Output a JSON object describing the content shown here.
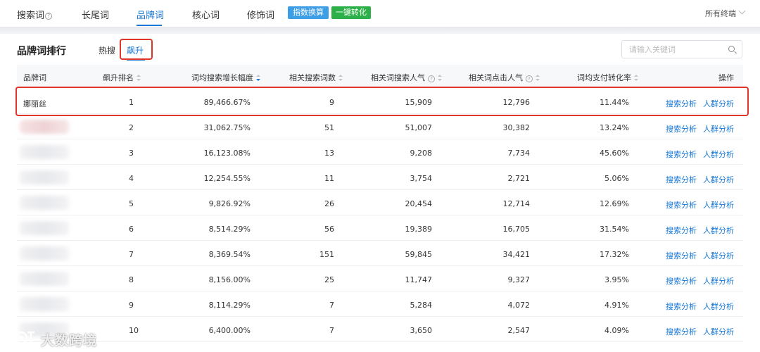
{
  "topnav": {
    "tabs": [
      {
        "label": "搜索词",
        "help": "?"
      },
      {
        "label": "长尾词"
      },
      {
        "label": "品牌词"
      },
      {
        "label": "核心词"
      },
      {
        "label": "修饰词"
      }
    ],
    "active_tab": "品牌词",
    "index_convert_label": "指数换算",
    "one_click_convert_label": "一键转化",
    "terminal_label": "所有终端",
    "colors": {
      "accent": "#1677d6",
      "index_convert": "#3d9ee6",
      "one_click_convert": "#2db04a",
      "highlight": "#e0352b"
    }
  },
  "toolbar": {
    "title": "品牌词排行",
    "subtabs": [
      {
        "label": "热搜"
      },
      {
        "label": "飙升"
      }
    ],
    "active_subtab": "飙升",
    "search_placeholder": "请输入关键词",
    "search_icon": "search-icon"
  },
  "table": {
    "columns": {
      "brand": "品牌词",
      "rank": "飙升排名",
      "growth": "词均搜索增长幅度",
      "count": "相关搜索词数",
      "search_pop": "相关词搜索人气",
      "click_pop": "相关词点击人气",
      "conv": "词均支付转化率",
      "ops": "操作"
    },
    "help_mark": "?",
    "action_search": "搜索分析",
    "action_crowd": "人群分析",
    "rows": [
      {
        "brand": "娜丽丝",
        "rank": "1",
        "growth": "89,466.67%",
        "count": "9",
        "search_pop": "15,909",
        "click_pop": "12,796",
        "conv": "11.44%"
      },
      {
        "brand": "",
        "rank": "2",
        "growth": "31,062.75%",
        "count": "51",
        "search_pop": "51,007",
        "click_pop": "30,382",
        "conv": "13.24%"
      },
      {
        "brand": "",
        "rank": "3",
        "growth": "16,123.08%",
        "count": "13",
        "search_pop": "9,208",
        "click_pop": "7,734",
        "conv": "45.60%"
      },
      {
        "brand": "",
        "rank": "4",
        "growth": "12,254.55%",
        "count": "11",
        "search_pop": "3,754",
        "click_pop": "2,721",
        "conv": "5.06%"
      },
      {
        "brand": "",
        "rank": "5",
        "growth": "9,826.92%",
        "count": "26",
        "search_pop": "20,454",
        "click_pop": "12,714",
        "conv": "12.69%"
      },
      {
        "brand": "",
        "rank": "6",
        "growth": "8,514.29%",
        "count": "56",
        "search_pop": "19,389",
        "click_pop": "16,705",
        "conv": "31.54%"
      },
      {
        "brand": "",
        "rank": "7",
        "growth": "8,369.54%",
        "count": "151",
        "search_pop": "59,845",
        "click_pop": "34,421",
        "conv": "17.32%"
      },
      {
        "brand": "",
        "rank": "8",
        "growth": "8,156.00%",
        "count": "25",
        "search_pop": "11,747",
        "click_pop": "9,327",
        "conv": "3.95%"
      },
      {
        "brand": "",
        "rank": "9",
        "growth": "8,114.29%",
        "count": "7",
        "search_pop": "5,284",
        "click_pop": "4,072",
        "conv": "4.91%"
      },
      {
        "brand": "",
        "rank": "10",
        "growth": "6,400.00%",
        "count": "7",
        "search_pop": "3,650",
        "click_pop": "2,547",
        "conv": "4.09%"
      }
    ]
  },
  "watermark": {
    "text": "大数跨境"
  }
}
